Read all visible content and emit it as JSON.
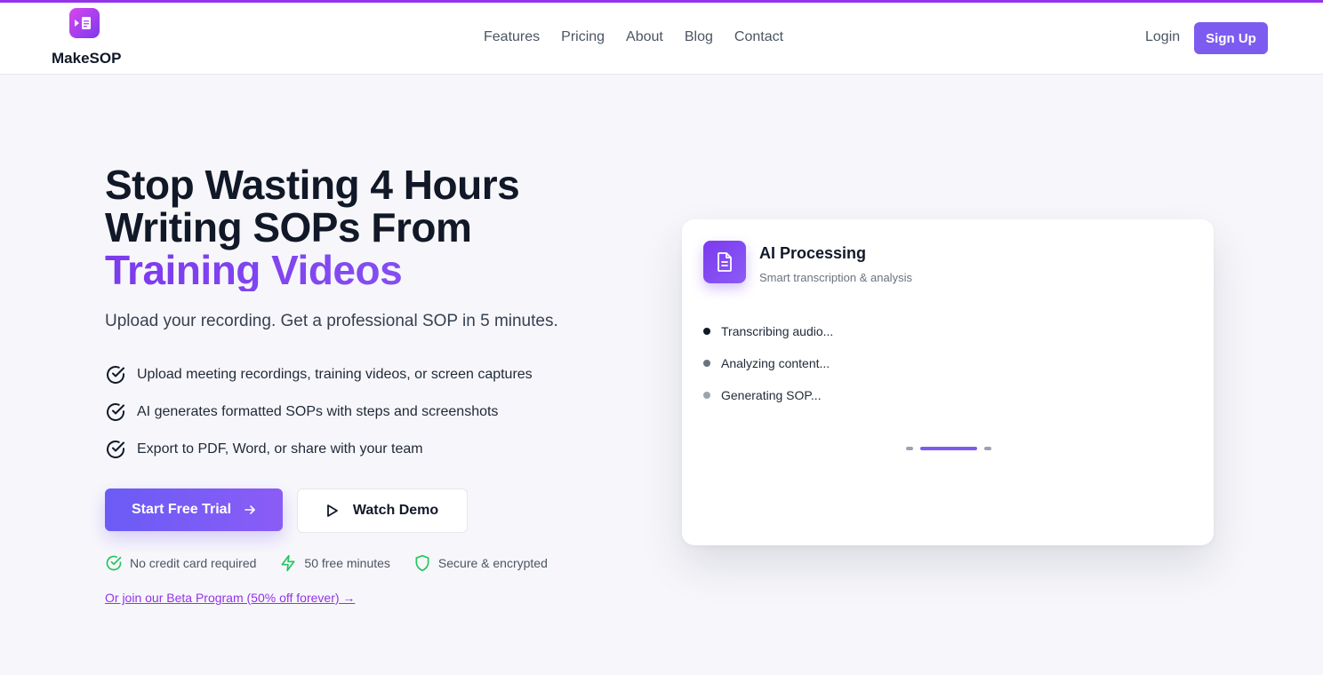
{
  "brand": {
    "name": "MakeSOP",
    "logo_icon": "video-document-icon"
  },
  "nav": {
    "links": [
      "Features",
      "Pricing",
      "About",
      "Blog",
      "Contact"
    ],
    "login": "Login",
    "signup": "Sign Up"
  },
  "hero": {
    "title_line1": "Stop Wasting 4 Hours",
    "title_line2": "Writing SOPs From",
    "title_highlight": "Training Videos",
    "subtitle": "Upload your recording. Get a professional SOP in 5 minutes.",
    "features": [
      "Upload meeting recordings, training videos, or screen captures",
      "AI generates formatted SOPs with steps and screenshots",
      "Export to PDF, Word, or share with your team"
    ],
    "cta_primary": "Start Free Trial",
    "cta_secondary": "Watch Demo",
    "trust": [
      "No credit card required",
      "50 free minutes",
      "Secure & encrypted"
    ],
    "beta_link": "Or join our Beta Program (50% off forever) →"
  },
  "card": {
    "title": "AI Processing",
    "subtitle": "Smart transcription & analysis",
    "steps": [
      "Transcribing audio...",
      "Analyzing content...",
      "Generating SOP..."
    ]
  },
  "colors": {
    "accent": "#7c5cf0",
    "brand_purple": "#9333ea",
    "success": "#22c55e"
  }
}
